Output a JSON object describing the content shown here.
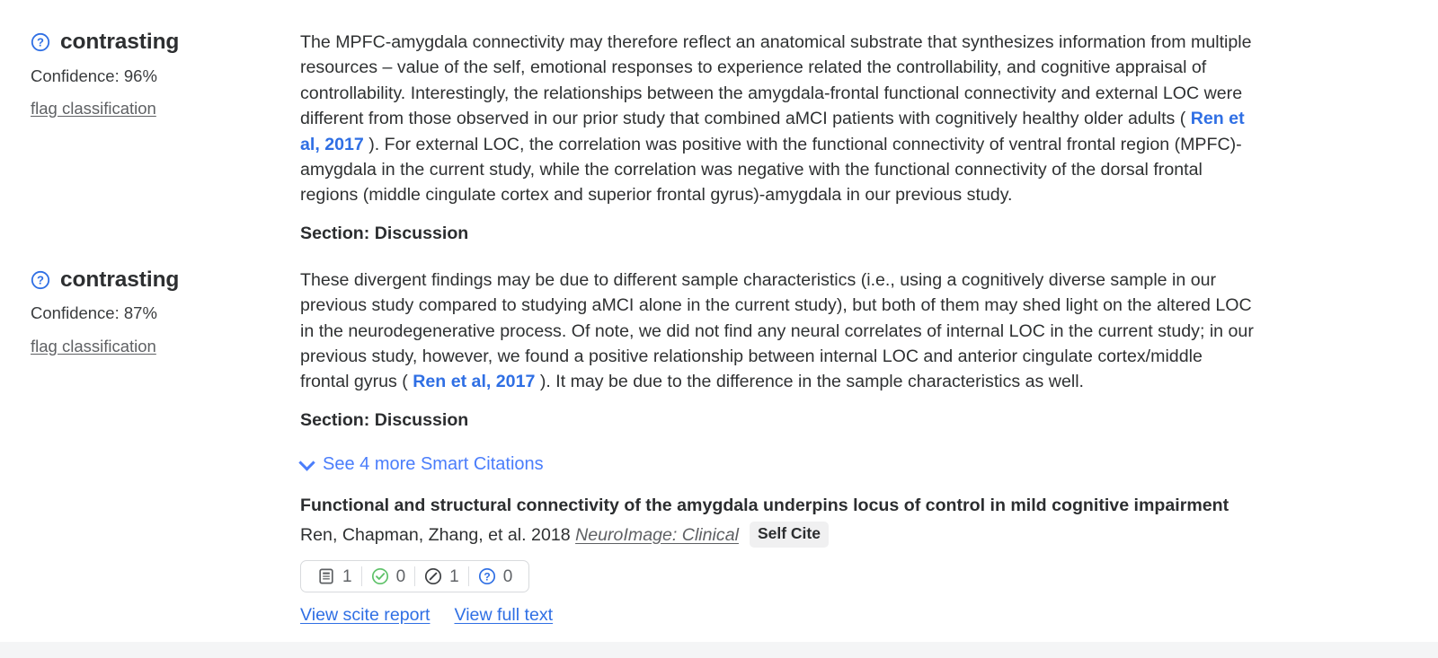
{
  "citations": [
    {
      "classification": "contrasting",
      "classification_icon": "question-circle-icon",
      "confidence": "Confidence: 96%",
      "flag_label": "flag classification",
      "quote_part1": "The MPFC-amygdala connectivity may therefore reflect an anatomical substrate that synthesizes information from multiple resources – value of the self, emotional responses to experience related the controllability, and cognitive appraisal of controllability. Interestingly, the relationships between the amygdala-frontal functional connectivity and external LOC were different from those observed in our prior study that combined aMCI patients with cognitively healthy older adults ( ",
      "quote_link": "Ren et al, 2017",
      "quote_part2": " ). For external LOC, the correlation was positive with the functional connectivity of ventral frontal region (MPFC)-amygdala in the current study, while the correlation was negative with the functional connectivity of the dorsal frontal regions (middle cingulate cortex and superior frontal gyrus)-amygdala in our previous study.",
      "section": "Section: Discussion"
    },
    {
      "classification": "contrasting",
      "classification_icon": "question-circle-icon",
      "confidence": "Confidence: 87%",
      "flag_label": "flag classification",
      "quote_part1": "These divergent findings may be due to different sample characteristics (i.e., using a cognitively diverse sample in our previous study compared to studying aMCI alone in the current study), but both of them may shed light on the altered LOC in the neurodegenerative process. Of note, we did not find any neural correlates of internal LOC in the current study; in our previous study, however, we found a positive relationship between internal LOC and anterior cingulate cortex/middle frontal gyrus ( ",
      "quote_link": "Ren et al, 2017",
      "quote_part2": " ). It may be due to the difference in the sample characteristics as well.",
      "section": "Section: Discussion"
    }
  ],
  "see_more": {
    "label": "See 4 more Smart Citations",
    "icon": "chevron-down-icon"
  },
  "paper": {
    "title": "Functional and structural connectivity of the amygdala underpins locus of control in mild cognitive impairment",
    "authors": "Ren, Chapman, Zhang, et al. 2018 ",
    "journal": "NeuroImage: Clinical",
    "self_cite_badge": "Self Cite",
    "stats": [
      {
        "icon": "document-icon",
        "count": "1"
      },
      {
        "icon": "check-circle-icon",
        "count": "0"
      },
      {
        "icon": "slash-circle-icon",
        "count": "1"
      },
      {
        "icon": "question-circle-icon",
        "count": "0"
      }
    ],
    "links": [
      {
        "label": "View scite report"
      },
      {
        "label": "View full text"
      }
    ]
  },
  "colors": {
    "link_blue": "#2f6fe4",
    "see_more_blue": "#4a7dfb",
    "support_green": "#4caf50",
    "mention_dark": "#3c3f42",
    "question_blue": "#2f6fe4",
    "badge_gray": "#f0f0f1"
  }
}
